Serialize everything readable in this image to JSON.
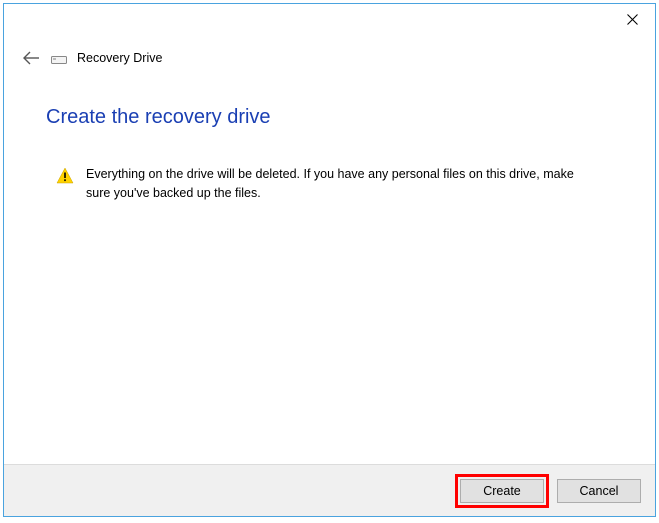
{
  "titlebar": {
    "app_name": "Recovery Drive"
  },
  "content": {
    "heading": "Create the recovery drive",
    "warning_message": "Everything on the drive will be deleted. If you have any personal files on this drive, make sure you've backed up the files."
  },
  "footer": {
    "create_label": "Create",
    "cancel_label": "Cancel"
  },
  "colors": {
    "accent": "#1a3fb3",
    "border": "#4aa3df",
    "highlight": "#ff0000"
  }
}
